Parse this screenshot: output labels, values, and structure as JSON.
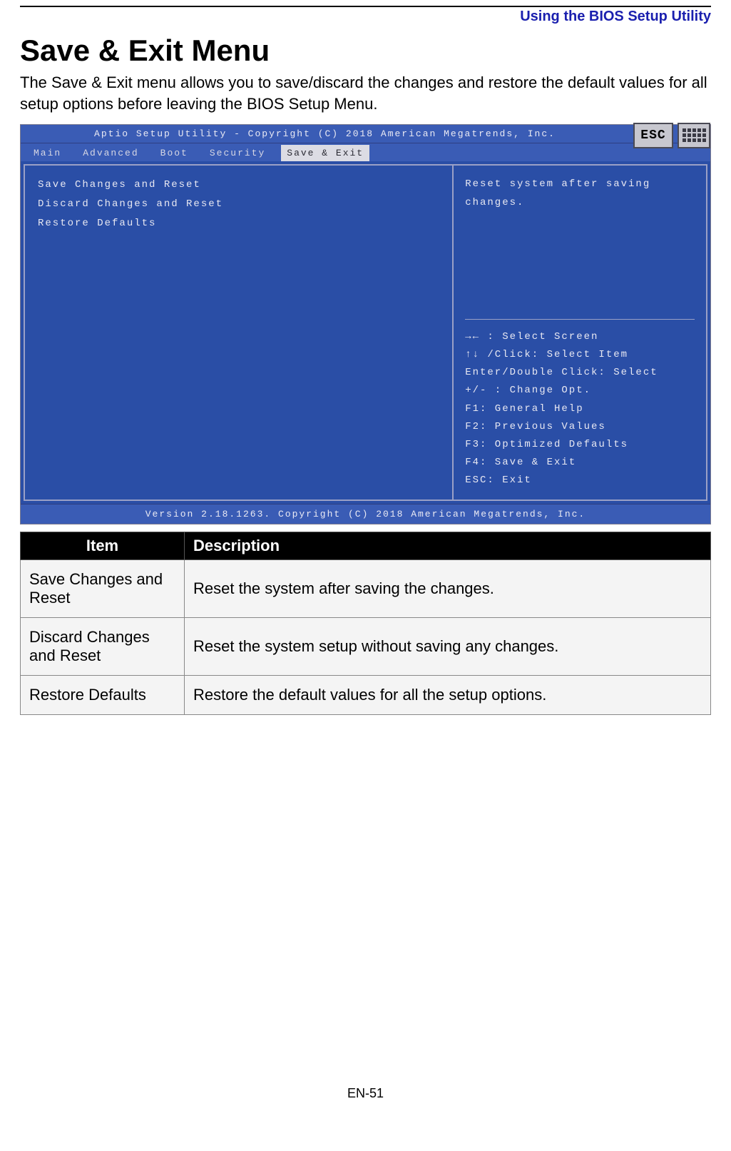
{
  "breadcrumb": "Using the BIOS Setup Utility",
  "heading": "Save & Exit Menu",
  "intro": "The Save & Exit menu allows you to save/discard the changes and restore the default values for all setup options before leaving the BIOS Setup Menu.",
  "bios": {
    "title": "Aptio Setup Utility - Copyright (C) 2018 American Megatrends, Inc.",
    "esc_label": "ESC",
    "tabs": [
      "Main",
      "Advanced",
      "Boot",
      "Security",
      "Save & Exit"
    ],
    "active_tab_index": 4,
    "menu_items": [
      "Save Changes and Reset",
      "Discard Changes and Reset",
      "",
      "Restore Defaults"
    ],
    "help_text": "Reset system after saving changes.",
    "key_help": [
      "→← : Select Screen",
      "↑↓ /Click: Select Item",
      "Enter/Double Click: Select",
      "+/- : Change Opt.",
      "F1: General Help",
      "F2: Previous Values",
      "F3: Optimized Defaults",
      "F4: Save & Exit",
      "ESC: Exit"
    ],
    "footer": "Version 2.18.1263. Copyright (C) 2018 American Megatrends, Inc."
  },
  "table": {
    "headers": {
      "item": "Item",
      "description": "Description"
    },
    "rows": [
      {
        "item": "Save Changes and Reset",
        "desc": "Reset the system after saving the changes."
      },
      {
        "item": "Discard Changes and Reset",
        "desc": "Reset the system setup without saving any changes."
      },
      {
        "item": "Restore Defaults",
        "desc": "Restore the default values for all the setup options."
      }
    ]
  },
  "page_number": "EN-51"
}
